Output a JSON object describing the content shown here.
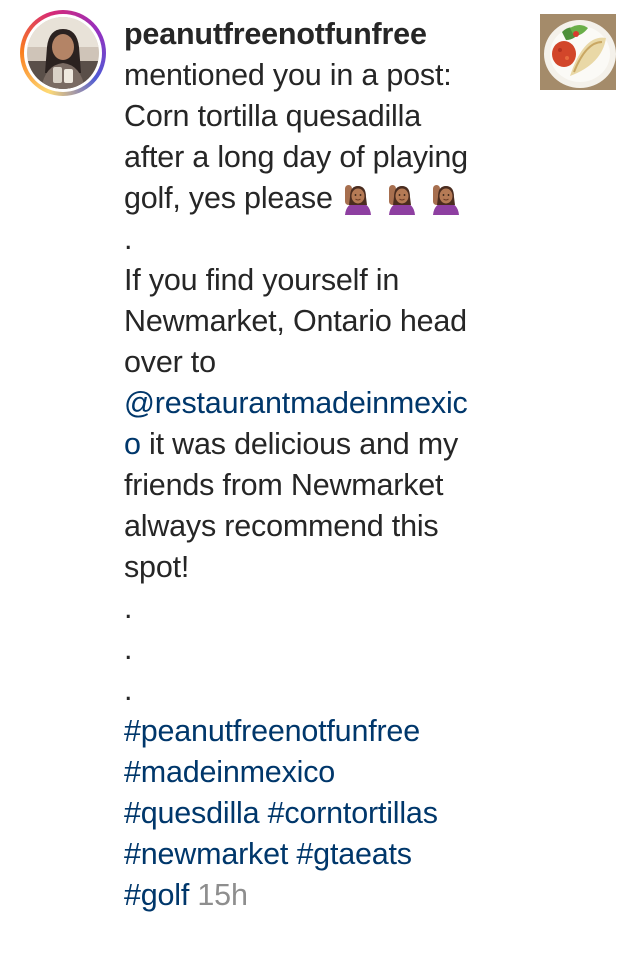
{
  "notification": {
    "username": "peanutfreenotfunfree",
    "action": "mentioned you in a post:",
    "caption_lines": [
      "Corn tortilla quesadilla",
      "after a long day of playing",
      "golf, yes please"
    ],
    "emoji_name": "person-raising-hand-emoji",
    "separator": ".",
    "body_lines": [
      "If you find yourself in",
      "Newmarket, Ontario head",
      "over to"
    ],
    "mention_line_1": "@restaurantmadeinmexic",
    "mention_line_2": "o",
    "after_mention_lines": [
      " it was delicious and my",
      "friends from Newmarket",
      "always recommend this",
      "spot!"
    ],
    "hashtags": {
      "line_1": "#peanutfreenotfunfree",
      "line_2": "#madeinmexico",
      "line_3a": "#quesdilla",
      "line_3b": "#corntortillas",
      "line_4a": "#newmarket",
      "line_4b": "#gtaeats",
      "line_5": "#golf"
    },
    "timestamp": "15h"
  },
  "colors": {
    "text": "#262626",
    "link": "#00376b",
    "timestamp": "#8e8e8e"
  },
  "icons": {
    "avatar": "profile-photo",
    "post_thumbnail": "quesadilla-plate-photo"
  }
}
